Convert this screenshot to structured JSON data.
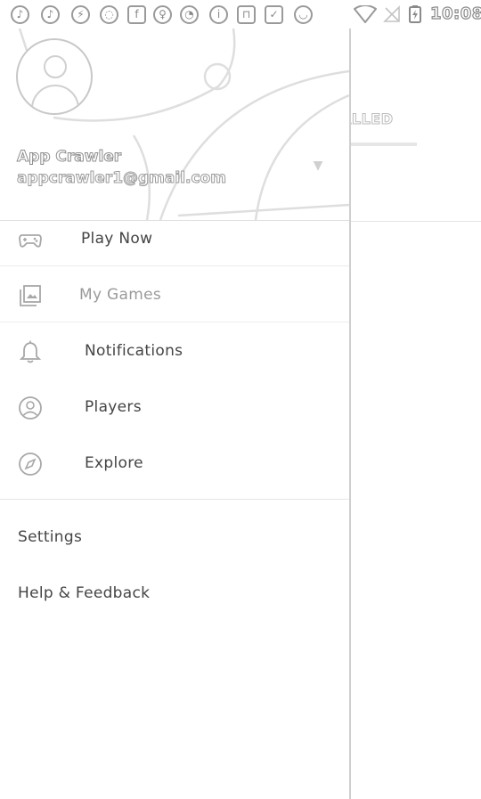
{
  "status_bar": {
    "notification_icons": [
      {
        "icon": "music-note-icon",
        "glyph": "♪"
      },
      {
        "icon": "music-note-icon",
        "glyph": "♪"
      },
      {
        "icon": "bolt-icon",
        "glyph": "⚡"
      },
      {
        "icon": "shield-icon",
        "glyph": "◌"
      },
      {
        "icon": "facebook-icon",
        "glyph": "f"
      },
      {
        "icon": "pin-icon",
        "glyph": "♀"
      },
      {
        "icon": "pikachu-icon",
        "glyph": "◔"
      },
      {
        "icon": "info-icon",
        "glyph": "i"
      },
      {
        "icon": "lock-icon",
        "glyph": "⊓"
      },
      {
        "icon": "calendar-check-icon",
        "glyph": "✓"
      },
      {
        "icon": "android-icon",
        "glyph": "◡"
      }
    ],
    "time": "10:08"
  },
  "background_app": {
    "tab_label": "ALLED"
  },
  "drawer": {
    "account": {
      "name": "App Crawler",
      "email": "appcrawler1@gmail.com"
    },
    "items": [
      {
        "label": "Play Now",
        "icon": "gamepad-icon"
      },
      {
        "label": "My Games",
        "icon": "library-icon"
      },
      {
        "label": "Notifications",
        "icon": "bell-icon"
      },
      {
        "label": "Players",
        "icon": "person-circle-icon"
      },
      {
        "label": "Explore",
        "icon": "compass-icon"
      }
    ],
    "secondary": {
      "settings": "Settings",
      "help": "Help & Feedback"
    }
  }
}
